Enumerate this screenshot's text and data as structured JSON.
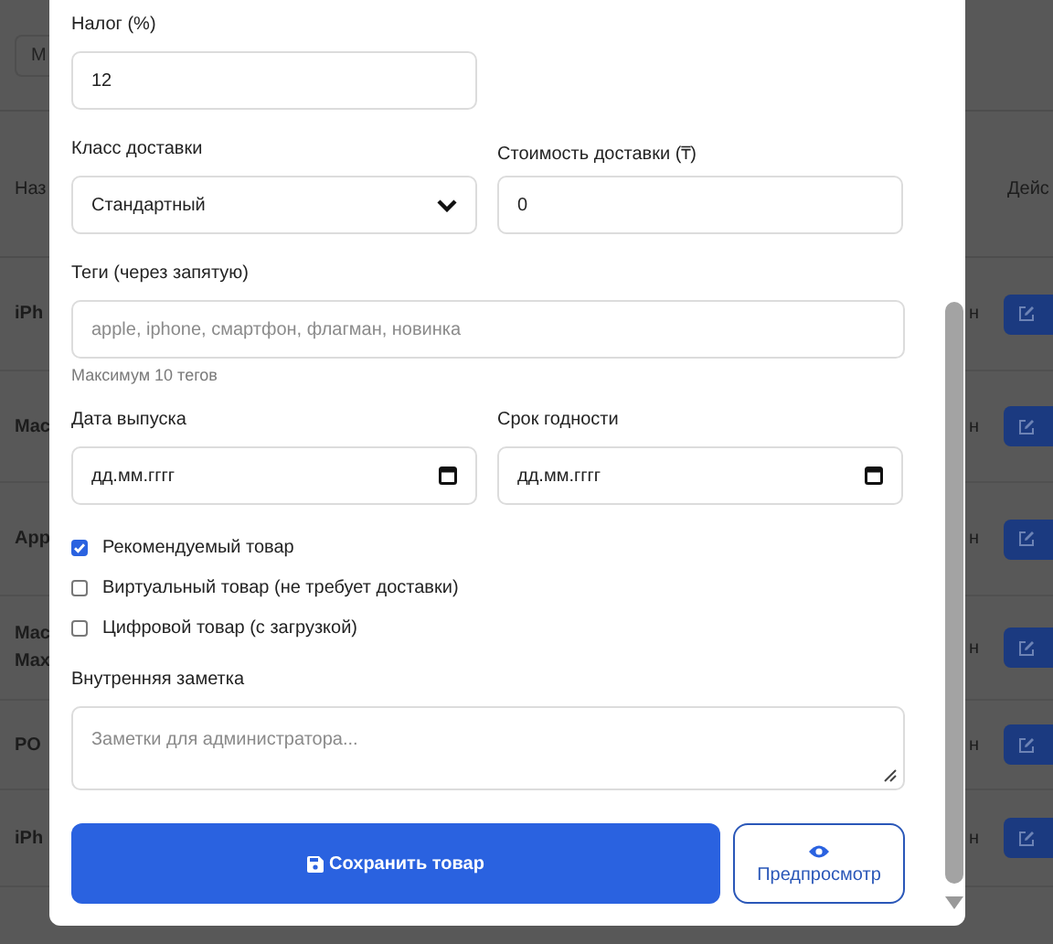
{
  "background_page": {
    "top_button": "M",
    "name_header": "Наз",
    "actions_header": "Дейс",
    "rows": [
      {
        "name_lines": [
          "iPh"
        ],
        "status": "н"
      },
      {
        "name_lines": [
          "Mac"
        ],
        "status": "н"
      },
      {
        "name_lines": [
          "App"
        ],
        "status": "н"
      },
      {
        "name_lines": [
          "Mac",
          "Max"
        ],
        "status": "н"
      },
      {
        "name_lines": [
          "PO"
        ],
        "status": "н"
      },
      {
        "name_lines": [
          "iPh"
        ],
        "status": "н"
      }
    ]
  },
  "form": {
    "field_rows": [
      [
        {
          "kind": "input",
          "label": "Налог (%)",
          "value": "12",
          "full": false
        }
      ],
      [
        {
          "kind": "select",
          "label": "Класс доставки",
          "value": "Стандартный",
          "full": false
        },
        {
          "kind": "input",
          "label": "Стоимость доставки (₸)",
          "value": "0",
          "full": false
        }
      ],
      [
        {
          "kind": "input",
          "label": "Теги (через запятую)",
          "placeholder": "apple, iphone, смартфон, флагман, новинка",
          "hint": "Максимум 10 тегов",
          "full": true
        }
      ],
      [
        {
          "kind": "date",
          "label": "Дата выпуска",
          "value": "дд.мм.гггг",
          "full": false
        },
        {
          "kind": "date",
          "label": "Срок годности",
          "value": "дд.мм.гггг",
          "full": false
        }
      ]
    ],
    "checkboxes": [
      {
        "label": "Рекомендуемый товар",
        "checked": true
      },
      {
        "label": "Виртуальный товар (не требует доставки)",
        "checked": false
      },
      {
        "label": "Цифровой товар (с загрузкой)",
        "checked": false
      }
    ],
    "note": {
      "label": "Внутренняя заметка",
      "placeholder": "Заметки для администратора..."
    },
    "save_button": "Сохранить товар",
    "preview_button": "Предпросмотр"
  }
}
